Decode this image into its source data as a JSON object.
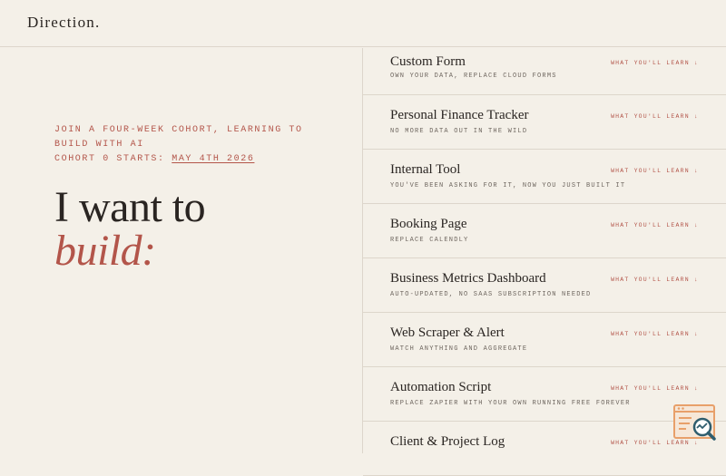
{
  "header": {
    "logo": "Direction."
  },
  "intro": {
    "line1": "Join a four-week cohort, learning to",
    "line2": "build with AI",
    "cohort_prefix": "Cohort 0 starts: ",
    "cohort_date": "May 4th 2026"
  },
  "headline": {
    "line1": "I want to",
    "line2": "build:"
  },
  "items": [
    {
      "title": "Custom Form",
      "subtitle": "Own your data, replace cloud forms",
      "link": "What you'll learn ↓"
    },
    {
      "title": "Personal Finance Tracker",
      "subtitle": "No more data out in the wild",
      "link": "What you'll learn ↓"
    },
    {
      "title": "Internal Tool",
      "subtitle": "You've been asking for it, now you just built it",
      "link": "What you'll learn ↓"
    },
    {
      "title": "Booking Page",
      "subtitle": "Replace Calendly",
      "link": "What you'll learn ↓"
    },
    {
      "title": "Business Metrics Dashboard",
      "subtitle": "Auto-updated, no SaaS subscription needed",
      "link": "What you'll learn ↓"
    },
    {
      "title": "Web Scraper & Alert",
      "subtitle": "Watch anything and aggregate",
      "link": "What you'll learn ↓"
    },
    {
      "title": "Automation Script",
      "subtitle": "Replace Zapier with your own running free forever",
      "link": "What you'll learn ↓"
    },
    {
      "title": "Client & Project Log",
      "subtitle": "",
      "link": "What you'll learn ↓"
    }
  ],
  "colors": {
    "background": "#f4f0e8",
    "accent": "#b3554a",
    "text": "#2a2522",
    "border": "#ddd6cb",
    "widget": "#e8a06a"
  },
  "icons": {
    "widget": "page-search-icon"
  }
}
